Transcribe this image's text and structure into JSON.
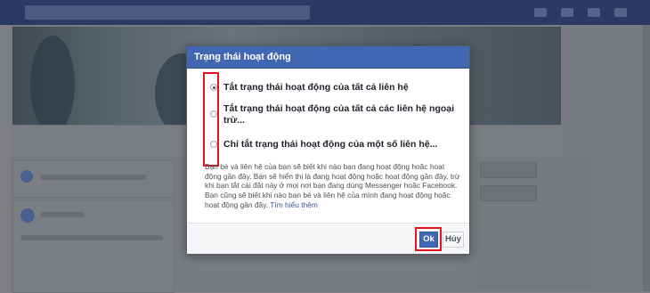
{
  "dialog": {
    "title": "Trạng thái hoạt động",
    "options": [
      {
        "label": "Tắt trạng thái hoạt động của tất cả liên hệ",
        "selected": true
      },
      {
        "label": "Tắt trạng thái hoạt động của tất cả các liên hệ ngoại trừ...",
        "selected": false
      },
      {
        "label": "Chỉ tắt trạng thái hoạt động của một số liên hệ...",
        "selected": false
      }
    ],
    "description": "Bạn bè và liên hệ của bạn sẽ biết khi nào bạn đang hoạt động hoặc hoạt động gần đây. Bạn sẽ hiển thị là đang hoạt động hoặc hoạt động gần đây, trừ khi bạn tắt cài đặt này ở mọi nơi bạn đang dùng Messenger hoặc Facebook. Bạn cũng sẽ biết khi nào bạn bè và liên hệ của mình đang hoạt động hoặc hoạt động gần đây.",
    "learn_more": "Tìm hiểu thêm",
    "ok_label": "Ok",
    "cancel_label": "Hủy"
  },
  "colors": {
    "header_blue": "#4267b2",
    "highlight_red": "#e0141e",
    "overlay_gray": "#7d7f83"
  }
}
